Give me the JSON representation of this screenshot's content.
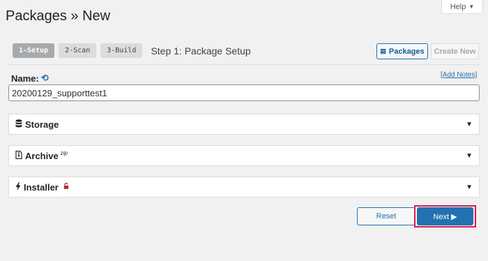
{
  "header": {
    "title": "Packages » New"
  },
  "help_tab": {
    "label": "Help",
    "icon": "caret-down-icon"
  },
  "steps": {
    "items": [
      {
        "label": "1-Setup",
        "active": true
      },
      {
        "label": "2-Scan",
        "active": false
      },
      {
        "label": "3-Build",
        "active": false
      }
    ],
    "current_title": "Step 1: Package Setup"
  },
  "toolbar": {
    "packages_label": "Packages",
    "create_new_label": "Create New"
  },
  "name_field": {
    "label": "Name:",
    "value": "20200129_supporttest1",
    "add_notes_link": "[Add Notes]"
  },
  "panels": [
    {
      "label": "Storage",
      "icon": "database-icon"
    },
    {
      "label": "Archive",
      "superscript": "zip",
      "icon": "archive-file-icon"
    },
    {
      "label": "Installer",
      "icon": "bolt-icon",
      "badge_icon": "lock-icon"
    }
  ],
  "actions": {
    "reset_label": "Reset",
    "next_label": "Next ▶"
  },
  "colors": {
    "accent": "#2271b1",
    "highlight_outline": "#e0194a",
    "lock": "#b32d2e"
  }
}
